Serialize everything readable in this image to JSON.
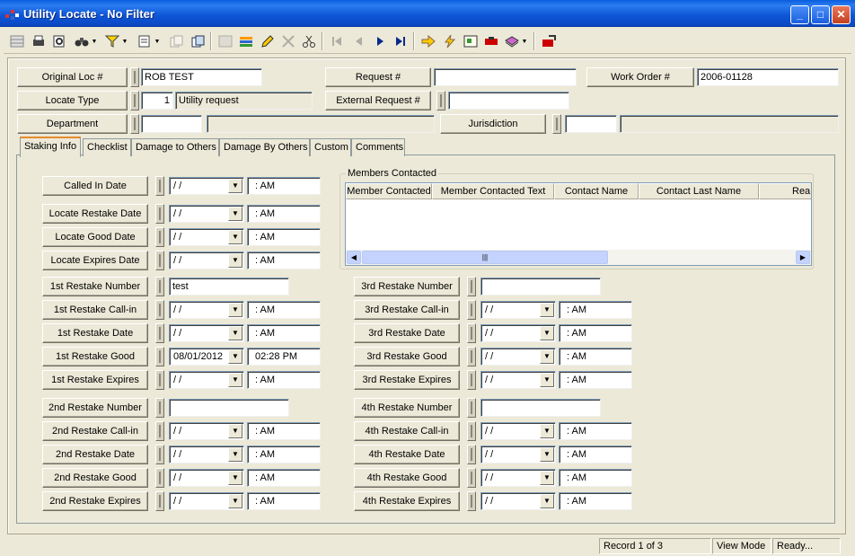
{
  "window": {
    "title": "Utility Locate - No Filter",
    "minimize": "_",
    "maximize": "□",
    "close": "✕"
  },
  "toolbar": {
    "icons": [
      "table-view-icon",
      "print-icon",
      "print-preview-icon",
      "binoculars-icon",
      "filter-icon",
      "form-icon",
      "copy-form-icon",
      "window-icon",
      "grid-icon",
      "layers-icon",
      "edit-pencil-icon",
      "delete-x-icon",
      "cut-scissors-icon",
      "first-record-icon",
      "previous-record-icon",
      "next-record-icon",
      "last-record-icon",
      "arrow-right-icon",
      "lightning-icon",
      "map-icon",
      "red-bar-icon",
      "books-icon",
      "export-icon"
    ]
  },
  "header": {
    "original_loc_label": "Original Loc #",
    "original_loc_value": "ROB TEST",
    "request_label": "Request #",
    "request_value": "",
    "work_order_label": "Work Order #",
    "work_order_value": "2006-01128",
    "locate_type_label": "Locate Type",
    "locate_type_code": "1",
    "locate_type_desc": "Utility request",
    "external_request_label": "External Request #",
    "external_request_value": "",
    "department_label": "Department",
    "department_code": "",
    "department_desc": "",
    "jurisdiction_label": "Jurisdiction",
    "jurisdiction_code": "",
    "jurisdiction_desc": ""
  },
  "tabs": [
    "Staking Info",
    "Checklist",
    "Damage to Others",
    "Damage By Others",
    "Custom",
    "Comments"
  ],
  "members": {
    "group_label": "Members Contacted",
    "columns": [
      "Member Contacted",
      "Member Contacted Text",
      "Contact Name",
      "Contact Last Name",
      "Rea"
    ],
    "scroll_grip": "|||"
  },
  "dates": {
    "called_in": {
      "label": "Called In Date",
      "date": " / /",
      "time": ":  AM"
    },
    "locate_restake": {
      "label": "Locate Restake Date",
      "date": " / /",
      "time": ":  AM"
    },
    "locate_good": {
      "label": "Locate Good Date",
      "date": " / /",
      "time": ":  AM"
    },
    "locate_expires": {
      "label": "Locate Expires Date",
      "date": " / /",
      "time": ":  AM"
    }
  },
  "restakes": {
    "first": {
      "number_label": "1st Restake Number",
      "number": "test",
      "callin_label": "1st Restake Call-in",
      "callin_date": " / /",
      "callin_time": ":  AM",
      "date_label": "1st Restake Date",
      "date_date": " / /",
      "date_time": ":  AM",
      "good_label": "1st Restake Good",
      "good_date": "08/01/2012",
      "good_time": "02:28 PM",
      "expires_label": "1st Restake Expires",
      "expires_date": " / /",
      "expires_time": ":  AM"
    },
    "second": {
      "number_label": "2nd Restake Number",
      "number": "",
      "callin_label": "2nd Restake Call-in",
      "callin_date": " / /",
      "callin_time": ":  AM",
      "date_label": "2nd Restake Date",
      "date_date": " / /",
      "date_time": ":  AM",
      "good_label": "2nd Restake Good",
      "good_date": " / /",
      "good_time": ":  AM",
      "expires_label": "2nd Restake Expires",
      "expires_date": " / /",
      "expires_time": ":  AM"
    },
    "third": {
      "number_label": "3rd Restake Number",
      "number": "",
      "callin_label": "3rd Restake Call-in",
      "callin_date": " / /",
      "callin_time": ":  AM",
      "date_label": "3rd Restake Date",
      "date_date": " / /",
      "date_time": ":  AM",
      "good_label": "3rd Restake Good",
      "good_date": " / /",
      "good_time": ":  AM",
      "expires_label": "3rd Restake Expires",
      "expires_date": " / /",
      "expires_time": ":  AM"
    },
    "fourth": {
      "number_label": "4th Restake Number",
      "number": "",
      "callin_label": "4th Restake Call-in",
      "callin_date": " / /",
      "callin_time": ":  AM",
      "date_label": "4th Restake Date",
      "date_date": " / /",
      "date_time": ":  AM",
      "good_label": "4th Restake Good",
      "good_date": " / /",
      "good_time": ":  AM",
      "expires_label": "4th Restake Expires",
      "expires_date": " / /",
      "expires_time": ":  AM"
    }
  },
  "status": {
    "record": "Record 1 of 3",
    "mode": "View Mode",
    "state": "Ready..."
  },
  "colors": {
    "titlebar": "#0b47c2",
    "tab_highlight": "#e68b2c",
    "background": "#ece9d8"
  }
}
